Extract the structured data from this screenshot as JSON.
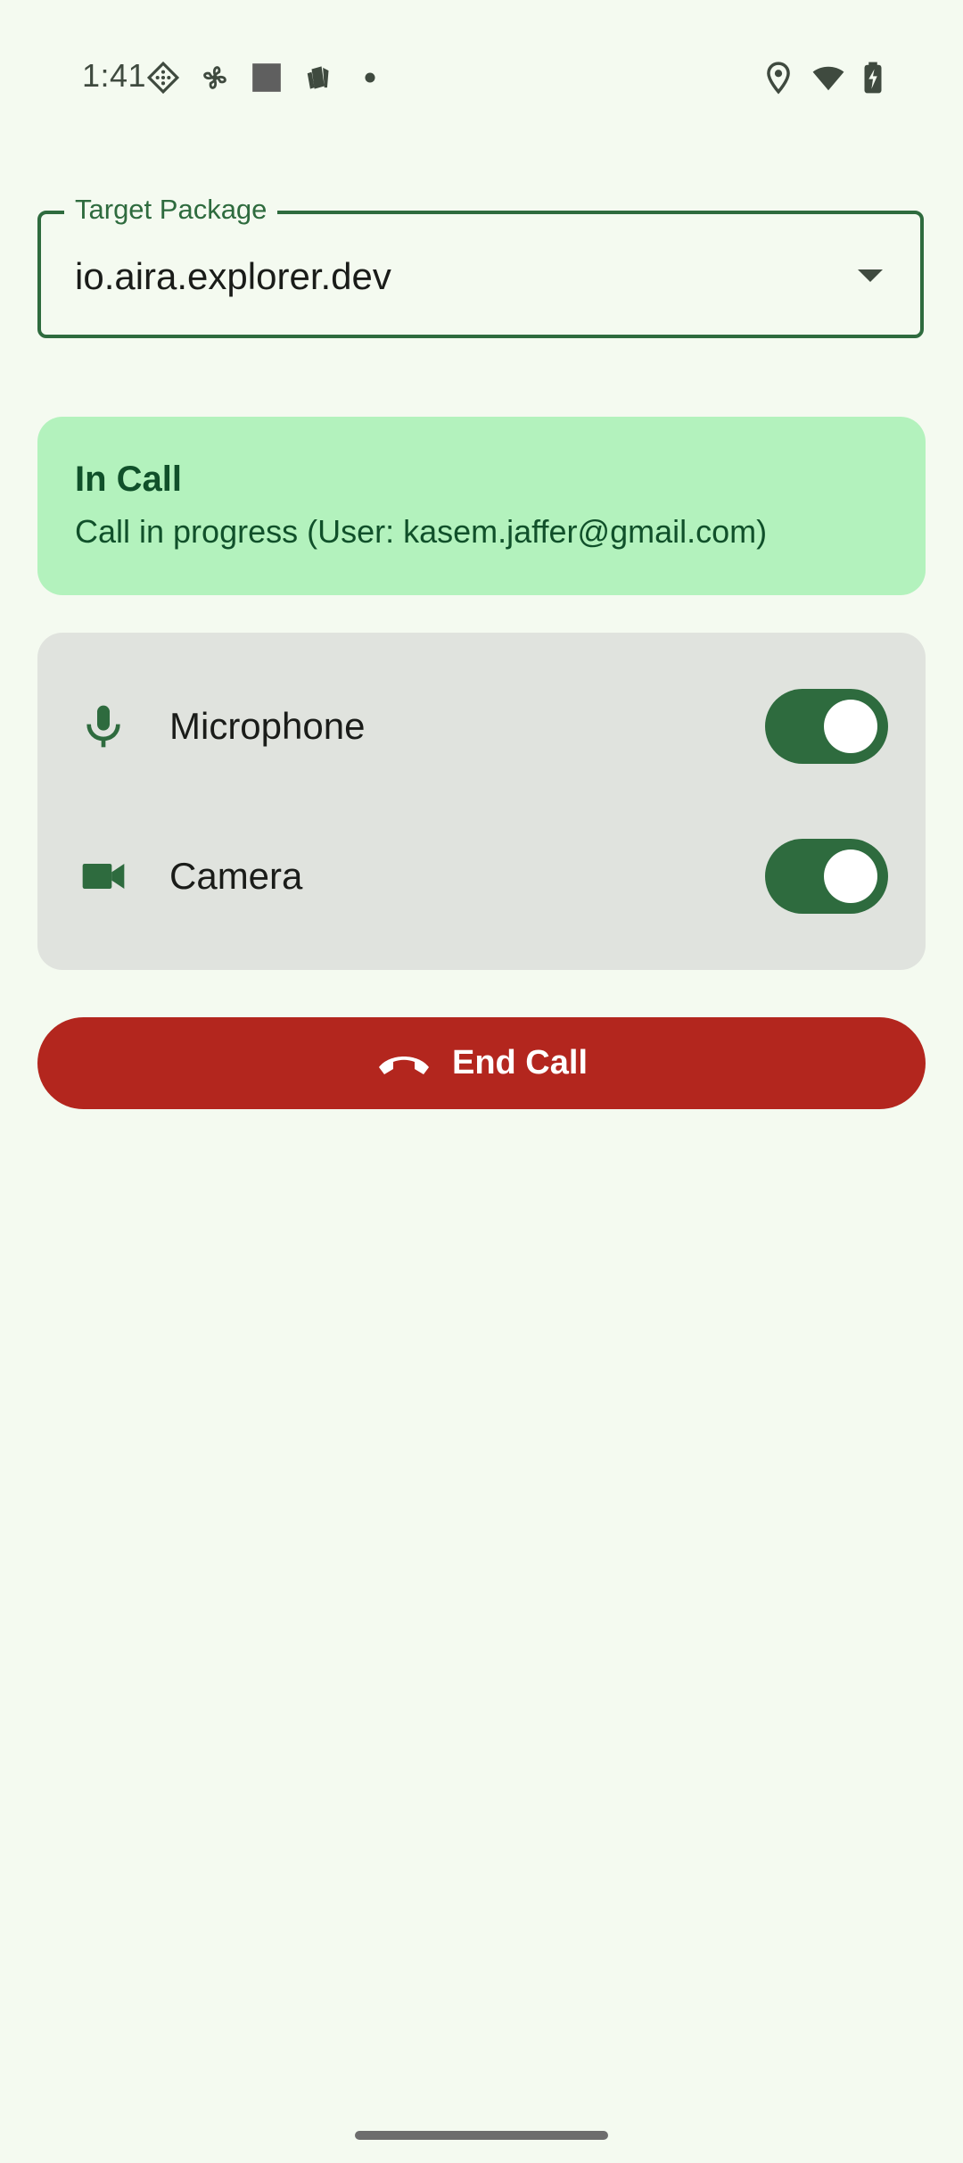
{
  "status_bar": {
    "time": "1:41",
    "icons": [
      "diamond-grid-icon",
      "fan-icon",
      "square-app-icon",
      "cards-icon",
      "dot-icon",
      "location-icon",
      "wifi-icon",
      "battery-charging-icon"
    ]
  },
  "target_package": {
    "label": "Target Package",
    "value": "io.aira.explorer.dev"
  },
  "call_status": {
    "title": "In Call",
    "message": "Call in progress (User: kasem.jaffer@gmail.com)"
  },
  "controls": {
    "microphone": {
      "label": "Microphone",
      "enabled": true
    },
    "camera": {
      "label": "Camera",
      "enabled": true
    }
  },
  "end_call": {
    "label": "End Call"
  },
  "colors": {
    "background": "#f4faf0",
    "accent": "#2e6b3e",
    "status_card": "#b3f2bd",
    "controls_card": "#e0e3de",
    "end_call": "#b3261e"
  }
}
